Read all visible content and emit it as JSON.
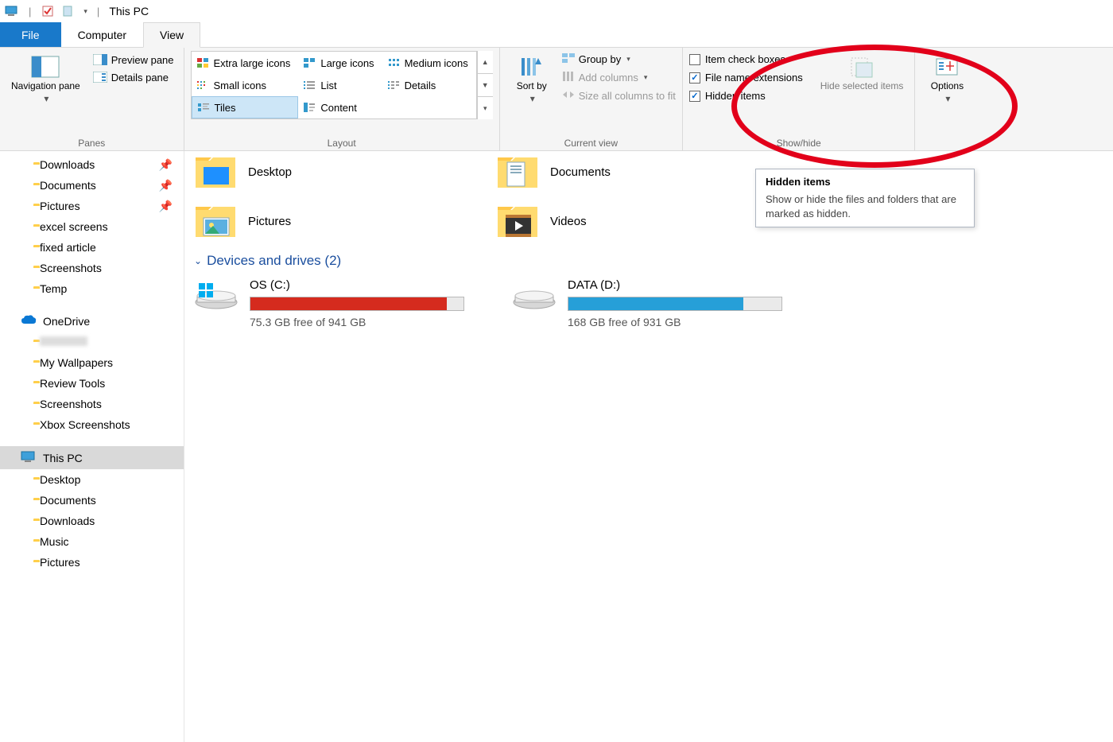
{
  "title": "This PC",
  "tabs": {
    "file": "File",
    "computer": "Computer",
    "view": "View"
  },
  "ribbon": {
    "panes": {
      "nav": "Navigation pane",
      "preview": "Preview pane",
      "details": "Details pane",
      "group": "Panes"
    },
    "layout": {
      "items": [
        "Extra large icons",
        "Large icons",
        "Medium icons",
        "Small icons",
        "List",
        "Details",
        "Tiles",
        "Content"
      ],
      "selected_index": 6,
      "group": "Layout"
    },
    "current_view": {
      "sort": "Sort by",
      "group_by": "Group by",
      "add_columns": "Add columns",
      "size_all": "Size all columns to fit",
      "group": "Current view"
    },
    "show_hide": {
      "item_checkboxes": {
        "label": "Item check boxes",
        "checked": false
      },
      "file_ext": {
        "label": "File name extensions",
        "checked": true
      },
      "hidden_items": {
        "label": "Hidden items",
        "checked": true
      },
      "hide_selected": "Hide selected items",
      "group": "Show/hide"
    },
    "options": "Options"
  },
  "sidebar": [
    {
      "label": "Downloads",
      "level": 1,
      "icon": "folder",
      "pinned": true
    },
    {
      "label": "Documents",
      "level": 1,
      "icon": "folder",
      "pinned": true
    },
    {
      "label": "Pictures",
      "level": 1,
      "icon": "folder",
      "pinned": true
    },
    {
      "label": "excel screens",
      "level": 1,
      "icon": "folder"
    },
    {
      "label": "fixed article",
      "level": 1,
      "icon": "folder"
    },
    {
      "label": "Screenshots",
      "level": 1,
      "icon": "folder"
    },
    {
      "label": "Temp",
      "level": 1,
      "icon": "folder"
    },
    {
      "label": "OneDrive",
      "level": 0,
      "icon": "onedrive",
      "mt": true
    },
    {
      "label": "",
      "level": 1,
      "icon": "folder",
      "redacted": true
    },
    {
      "label": "My Wallpapers",
      "level": 1,
      "icon": "folder"
    },
    {
      "label": "Review Tools",
      "level": 1,
      "icon": "folder"
    },
    {
      "label": "Screenshots",
      "level": 1,
      "icon": "folder"
    },
    {
      "label": "Xbox Screenshots",
      "level": 1,
      "icon": "folder"
    },
    {
      "label": "This PC",
      "level": 0,
      "icon": "pc",
      "selected": true,
      "mt": true
    },
    {
      "label": "Desktop",
      "level": 1,
      "icon": "folder"
    },
    {
      "label": "Documents",
      "level": 1,
      "icon": "folder"
    },
    {
      "label": "Downloads",
      "level": 1,
      "icon": "folder"
    },
    {
      "label": "Music",
      "level": 1,
      "icon": "folder"
    },
    {
      "label": "Pictures",
      "level": 1,
      "icon": "folder"
    }
  ],
  "content": {
    "folders": [
      {
        "name": "Desktop",
        "overlay": "desktop"
      },
      {
        "name": "Documents",
        "overlay": "docs"
      },
      {
        "name": "Pictures",
        "overlay": "pics"
      },
      {
        "name": "Videos",
        "overlay": "video"
      }
    ],
    "section_header": "Devices and drives (2)",
    "drives": [
      {
        "name": "OS (C:)",
        "free": "75.3 GB free of 941 GB",
        "fill_pct": 92,
        "color": "#d52b1e",
        "os": true
      },
      {
        "name": "DATA (D:)",
        "free": "168 GB free of 931 GB",
        "fill_pct": 82,
        "color": "#269fd8"
      }
    ]
  },
  "tooltip": {
    "title": "Hidden items",
    "body": "Show or hide the files and folders that are marked as hidden."
  }
}
